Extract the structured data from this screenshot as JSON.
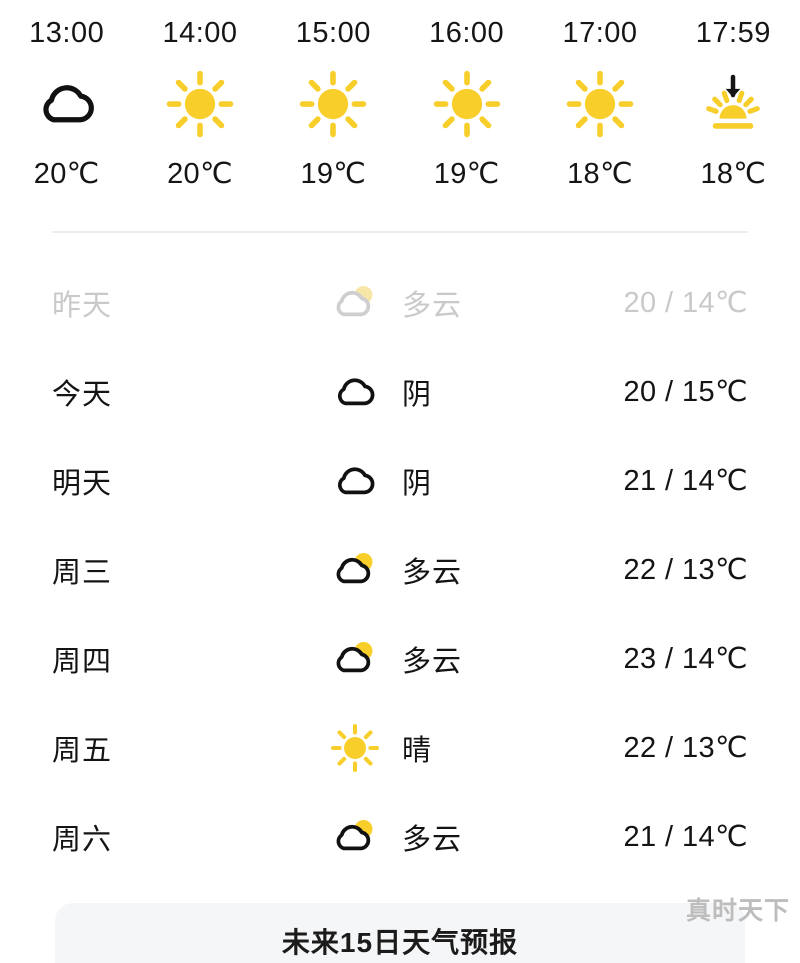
{
  "hourly": {
    "columns": [
      {
        "time": "13:00",
        "icon": "cloud-overcast-icon",
        "temp": "20℃"
      },
      {
        "time": "14:00",
        "icon": "sun-icon",
        "temp": "20℃"
      },
      {
        "time": "15:00",
        "icon": "sun-icon",
        "temp": "19℃"
      },
      {
        "time": "16:00",
        "icon": "sun-icon",
        "temp": "19℃"
      },
      {
        "time": "17:00",
        "icon": "sun-icon",
        "temp": "18℃"
      },
      {
        "time": "17:59",
        "icon": "sunset-icon",
        "temp": "18℃"
      }
    ]
  },
  "daily": {
    "rows": [
      {
        "day": "昨天",
        "icon": "cloud-partly-sunny-icon",
        "condition": "多云",
        "temp": "20 / 14℃",
        "past": true
      },
      {
        "day": "今天",
        "icon": "cloud-overcast-icon",
        "condition": "阴",
        "temp": "20 / 15℃",
        "past": false
      },
      {
        "day": "明天",
        "icon": "cloud-overcast-icon",
        "condition": "阴",
        "temp": "21 / 14℃",
        "past": false
      },
      {
        "day": "周三",
        "icon": "cloud-partly-sunny-icon",
        "condition": "多云",
        "temp": "22 / 13℃",
        "past": false
      },
      {
        "day": "周四",
        "icon": "cloud-partly-sunny-icon",
        "condition": "多云",
        "temp": "23 / 14℃",
        "past": false
      },
      {
        "day": "周五",
        "icon": "sun-icon",
        "condition": "晴",
        "temp": "22 / 13℃",
        "past": false
      },
      {
        "day": "周六",
        "icon": "cloud-partly-sunny-icon",
        "condition": "多云",
        "temp": "21 / 14℃",
        "past": false
      }
    ]
  },
  "bottom_card": {
    "title": "未来15日天气预报"
  },
  "watermark": {
    "text": "真时天下"
  },
  "colors": {
    "sun_yellow": "#F8CE2B",
    "text_primary": "#151515",
    "text_muted": "#C9C9C9",
    "divider": "#ECEDED",
    "card_bg": "#F5F6F7",
    "watermark": "#BDBDBD"
  }
}
